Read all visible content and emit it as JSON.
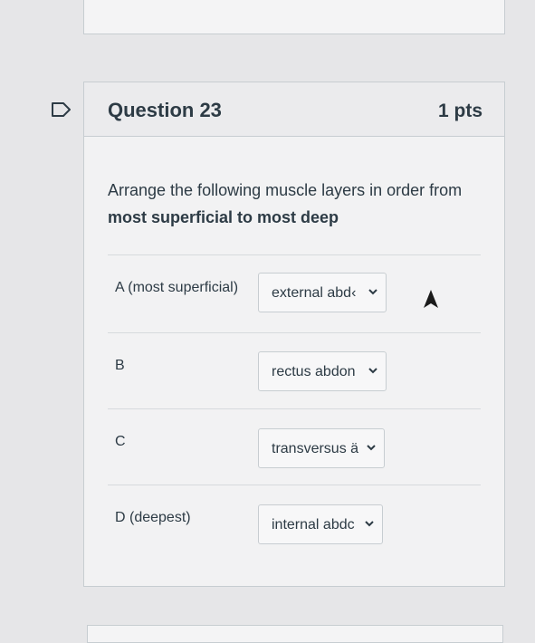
{
  "question": {
    "title": "Question 23",
    "points": "1 pts",
    "text_plain": "Arrange the following muscle layers in order from ",
    "text_bold": "most superficial to most deep"
  },
  "rows": [
    {
      "label": "A (most superficial)",
      "selected": "external abd‹"
    },
    {
      "label": "B",
      "selected": "rectus abdon"
    },
    {
      "label": "C",
      "selected": "transversus ä"
    },
    {
      "label": "D (deepest)",
      "selected": "internal abdc"
    }
  ],
  "icons": {
    "flag": "flag-outline-icon",
    "dropdown": "chevron-down-icon",
    "pointer": "mouse-pointer-icon"
  },
  "colors": {
    "text": "#2d3b45",
    "border": "#c7cdd1",
    "flag": "#2d3b45"
  }
}
